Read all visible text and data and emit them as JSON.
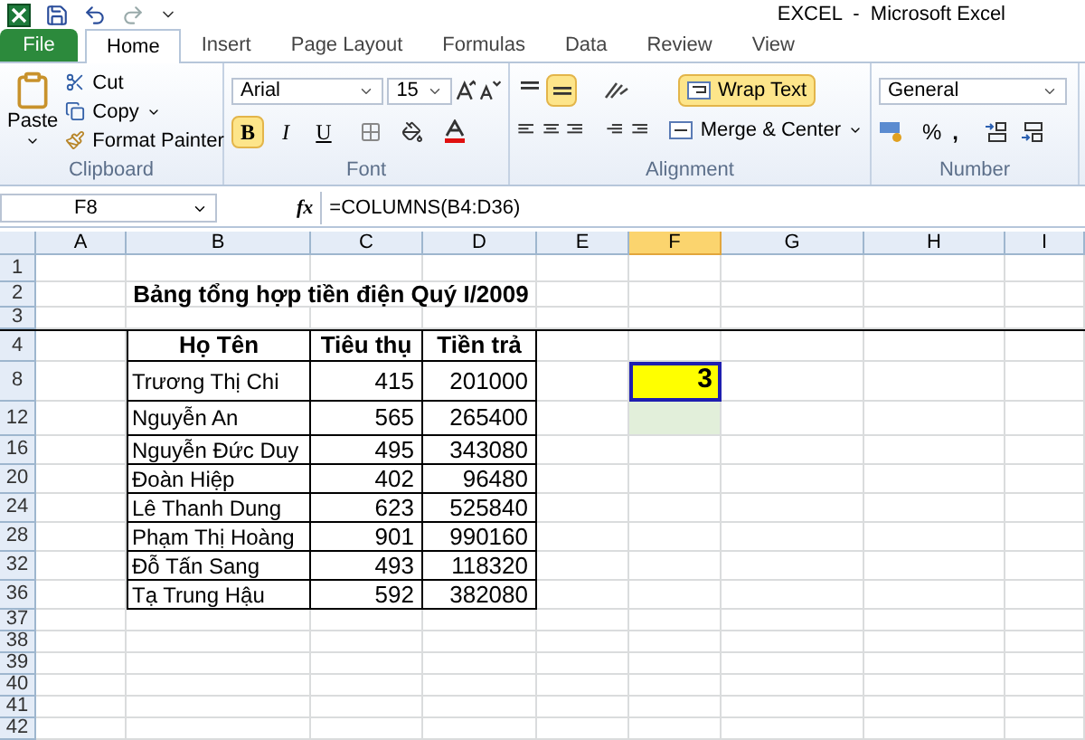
{
  "window": {
    "title": "EXCEL  -  Microsoft Excel"
  },
  "tabs": [
    {
      "label": "File",
      "kind": "file",
      "selected": false
    },
    {
      "label": "Home",
      "kind": "tab",
      "selected": true
    },
    {
      "label": "Insert",
      "kind": "tab",
      "selected": false
    },
    {
      "label": "Page Layout",
      "kind": "tab",
      "selected": false
    },
    {
      "label": "Formulas",
      "kind": "tab",
      "selected": false
    },
    {
      "label": "Data",
      "kind": "tab",
      "selected": false
    },
    {
      "label": "Review",
      "kind": "tab",
      "selected": false
    },
    {
      "label": "View",
      "kind": "tab",
      "selected": false
    }
  ],
  "ribbon": {
    "clipboard": {
      "label": "Clipboard",
      "paste": "Paste",
      "cut": "Cut",
      "copy": "Copy",
      "format_painter": "Format Painter"
    },
    "font": {
      "label": "Font",
      "family": "Arial",
      "size": "15",
      "bold": {
        "label": "B",
        "selected": true
      },
      "italic": {
        "label": "I",
        "selected": false
      },
      "underline": {
        "label": "U",
        "selected": false
      }
    },
    "alignment": {
      "label": "Alignment",
      "middle_align": {
        "selected": true
      },
      "wrap_text": {
        "label": "Wrap Text",
        "selected": true
      },
      "merge": "Merge & Center"
    },
    "number": {
      "label": "Number",
      "format": "General",
      "percent": "%",
      "comma": ","
    }
  },
  "formula_bar": {
    "name_box": "F8",
    "fx": "fx",
    "formula": "=COLUMNS(B4:D36)"
  },
  "sheet": {
    "columns": [
      {
        "label": "A",
        "selected": false
      },
      {
        "label": "B",
        "selected": false
      },
      {
        "label": "C",
        "selected": false
      },
      {
        "label": "D",
        "selected": false
      },
      {
        "label": "E",
        "selected": false
      },
      {
        "label": "F",
        "selected": true
      },
      {
        "label": "G",
        "selected": false
      },
      {
        "label": "H",
        "selected": false
      },
      {
        "label": "I",
        "selected": false
      }
    ],
    "rows": [
      {
        "header": "1"
      },
      {
        "header": "2",
        "title": "Bảng tổng hợp tiền điện Quý I/2009"
      },
      {
        "header": "3"
      },
      {
        "header": "4",
        "table_header": [
          "Họ Tên",
          "Tiêu thụ",
          "Tiền trả"
        ]
      },
      {
        "header": "8",
        "values": [
          "Trương Thị Chi",
          "415",
          "201000"
        ],
        "f_cell": {
          "text": "3",
          "color": "#ffff00",
          "selected": true
        }
      },
      {
        "header": "12",
        "values": [
          "Nguyễn An",
          "565",
          "265400"
        ],
        "f_cell": {
          "color": "#e2efda",
          "selected": false
        }
      },
      {
        "header": "16",
        "values": [
          "Nguyễn Đức Duy",
          "495",
          "343080"
        ]
      },
      {
        "header": "20",
        "values": [
          "Đoàn Hiệp",
          "402",
          "96480"
        ]
      },
      {
        "header": "24",
        "values": [
          "Lê Thanh Dung",
          "623",
          "525840"
        ]
      },
      {
        "header": "28",
        "values": [
          "Phạm Thị Hoàng",
          "901",
          "990160"
        ]
      },
      {
        "header": "32",
        "values": [
          "Đỗ Tấn Sang",
          "493",
          "118320"
        ]
      },
      {
        "header": "36",
        "values": [
          "Tạ Trung Hậu",
          "592",
          "382080"
        ]
      },
      {
        "header": "37"
      },
      {
        "header": "38"
      },
      {
        "header": "39"
      },
      {
        "header": "40"
      },
      {
        "header": "41"
      },
      {
        "header": "42"
      }
    ]
  }
}
